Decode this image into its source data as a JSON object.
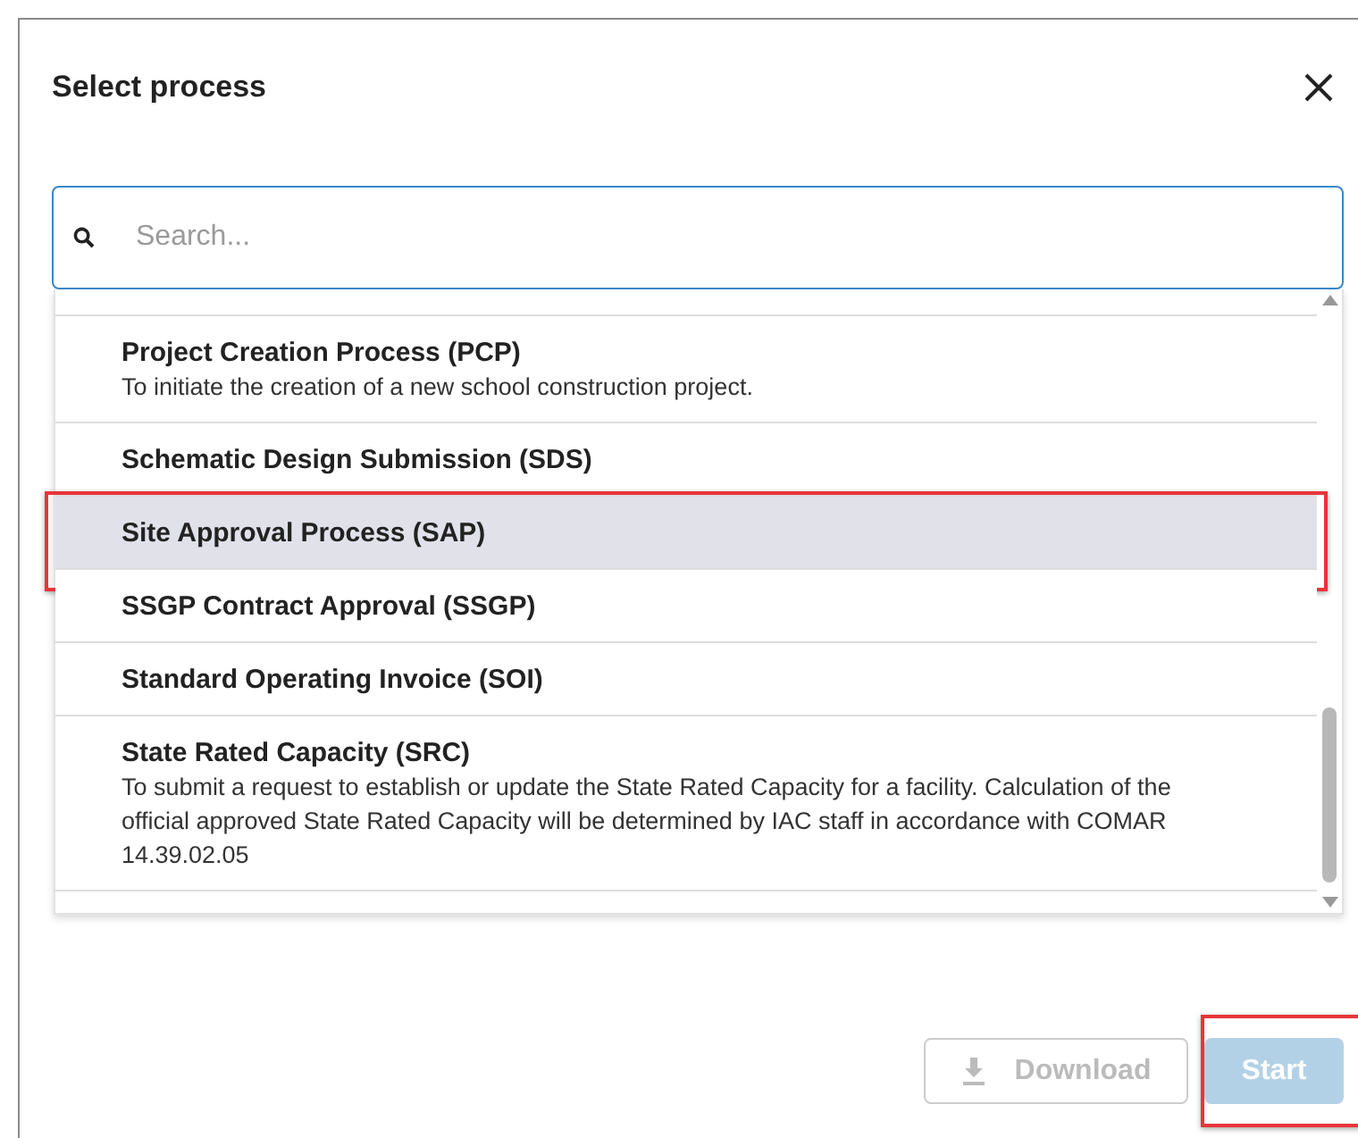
{
  "dialog": {
    "title": "Select process"
  },
  "search": {
    "placeholder": "Search..."
  },
  "processes": [
    {
      "name": "Project Creation Process (PCP)",
      "description": "To initiate the creation of a new school construction project.",
      "selected": false,
      "highlighted": false
    },
    {
      "name": "Schematic Design Submission (SDS)",
      "selected": false,
      "highlighted": false
    },
    {
      "name": "Site Approval Process (SAP)",
      "selected": true,
      "highlighted": true
    },
    {
      "name": "SSGP Contract Approval (SSGP)",
      "selected": false,
      "highlighted": false
    },
    {
      "name": "Standard Operating Invoice (SOI)",
      "selected": false,
      "highlighted": false
    },
    {
      "name": "State Rated Capacity (SRC)",
      "description": "To submit a request to establish or update the State Rated Capacity for a facility. Calculation of the official approved State Rated Capacity will be determined by IAC staff in accordance with COMAR 14.39.02.05",
      "selected": false,
      "highlighted": false
    }
  ],
  "buttons": [
    {
      "kind": "download",
      "label": "Download",
      "disabled": true,
      "highlighted": false
    },
    {
      "kind": "start",
      "label": "Start",
      "disabled": true,
      "highlighted": true
    }
  ]
}
